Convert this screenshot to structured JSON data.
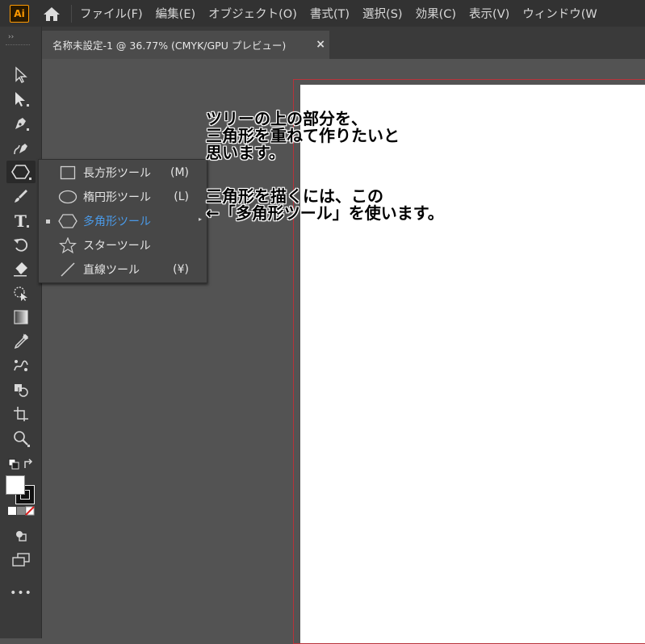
{
  "app": {
    "logo_text": "Ai"
  },
  "menu": [
    "ファイル(F)",
    "編集(E)",
    "オブジェクト(O)",
    "書式(T)",
    "選択(S)",
    "効果(C)",
    "表示(V)",
    "ウィンドウ(W"
  ],
  "document_tab": {
    "title": "名称未設定-1 @ 36.77% (CMYK/GPU プレビュー)",
    "close": "×"
  },
  "flyout": {
    "items": [
      {
        "label": "長方形ツール",
        "shortcut": "(M)",
        "icon": "rectangle-icon"
      },
      {
        "label": "楕円形ツール",
        "shortcut": "(L)",
        "icon": "ellipse-icon"
      },
      {
        "label": "多角形ツール",
        "shortcut": "",
        "icon": "polygon-icon",
        "selected": true
      },
      {
        "label": "スターツール",
        "shortcut": "",
        "icon": "star-icon"
      },
      {
        "label": "直線ツール",
        "shortcut": "(¥)",
        "icon": "line-icon"
      }
    ]
  },
  "annotation": {
    "block1": [
      "ツリーの上の部分を、",
      "三角形を重ねて作りたいと",
      "思います。"
    ],
    "block2": [
      "三角形を描くには、この",
      "←「多角形ツール」を使います。"
    ]
  },
  "toolbar": {
    "more": "•••"
  },
  "colors": {
    "accent": "#4a9ae8",
    "artboard_border": "#b8333a",
    "logo": "#ff9a00"
  }
}
